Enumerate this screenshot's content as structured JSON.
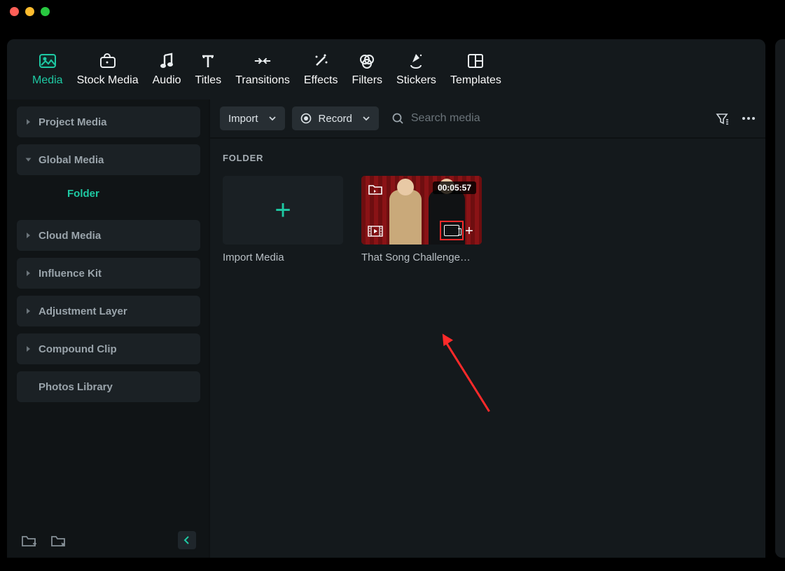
{
  "tabs": [
    {
      "label": "Media"
    },
    {
      "label": "Stock Media"
    },
    {
      "label": "Audio"
    },
    {
      "label": "Titles"
    },
    {
      "label": "Transitions"
    },
    {
      "label": "Effects"
    },
    {
      "label": "Filters"
    },
    {
      "label": "Stickers"
    },
    {
      "label": "Templates"
    }
  ],
  "sidebar": {
    "project_media": "Project Media",
    "global_media": "Global Media",
    "folder": "Folder",
    "cloud_media": "Cloud Media",
    "influence_kit": "Influence Kit",
    "adjustment_layer": "Adjustment Layer",
    "compound_clip": "Compound Clip",
    "photos_library": "Photos Library"
  },
  "toolbar": {
    "import_label": "Import",
    "record_label": "Record",
    "search_placeholder": "Search media"
  },
  "content": {
    "section_title": "FOLDER",
    "import_tile_caption": "Import Media",
    "video": {
      "caption": "That Song Challenge…",
      "duration": "00:05:57"
    }
  },
  "colors": {
    "accent": "#1ec9a3",
    "annotation": "#ff2a2a"
  }
}
